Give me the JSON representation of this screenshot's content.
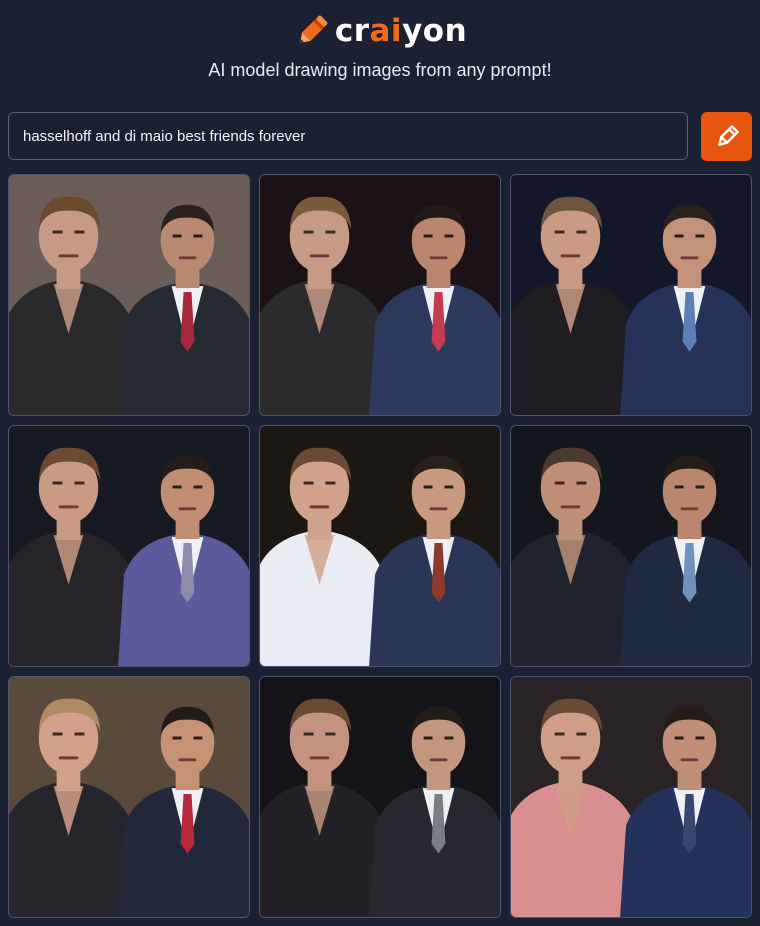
{
  "header": {
    "logo_prefix": "cr",
    "logo_accent": "ai",
    "logo_suffix": "yon",
    "logo_icon": "pencil-icon",
    "tagline": "AI model drawing images from any prompt!"
  },
  "prompt": {
    "value": "hasselhoff and di maio best friends forever",
    "draw_button_icon": "pencil-icon"
  },
  "colors": {
    "background": "#1a2133",
    "accent": "#e8550f",
    "tile_border": "#4d566c"
  },
  "results": {
    "images": [
      {
        "bg": "#6b5d58",
        "left_suit": "#2a2a2c",
        "left_skin": "#c79a85",
        "left_hair": "#6b4a2e",
        "right_suit": "#262a33",
        "right_skin": "#b98a72",
        "right_hair": "#2a201c",
        "tie": "#a7283a"
      },
      {
        "bg": "#1a1216",
        "left_suit": "#2b2a2d",
        "left_skin": "#c79a85",
        "left_hair": "#7a5a3c",
        "right_suit": "#2c3a5e",
        "right_skin": "#b9856c",
        "right_hair": "#231a16",
        "tie": "#c43a4e"
      },
      {
        "bg": "#14162a",
        "left_suit": "#1f1d22",
        "left_skin": "#c99b87",
        "left_hair": "#6f5540",
        "right_suit": "#26325a",
        "right_skin": "#c3927a",
        "right_hair": "#2a211c",
        "tie": "#5c7fb8"
      },
      {
        "bg": "#171a22",
        "left_suit": "#262428",
        "left_skin": "#c99a84",
        "left_hair": "#6b4a33",
        "right_suit": "#5b5a9a",
        "right_skin": "#c18e74",
        "right_hair": "#241c18",
        "tie": "#8c8cab"
      },
      {
        "bg": "#1d1714",
        "left_suit": "#e9ecf2",
        "left_skin": "#d0a28c",
        "left_hair": "#6a4a34",
        "right_suit": "#2b3558",
        "right_skin": "#c8987f",
        "right_hair": "#2a211d",
        "tie": "#8b3a2c"
      },
      {
        "bg": "#14161d",
        "left_suit": "#20232e",
        "left_skin": "#c08f7a",
        "left_hair": "#4d3a2e",
        "right_suit": "#1f2940",
        "right_skin": "#b9876e",
        "right_hair": "#251d18",
        "tie": "#6f92bc"
      },
      {
        "bg": "#5a4a3c",
        "left_suit": "#25262b",
        "left_skin": "#d2a18a",
        "left_hair": "#b08a62",
        "right_suit": "#23273a",
        "right_skin": "#c69274",
        "right_hair": "#231b16",
        "tie": "#b8283a"
      },
      {
        "bg": "#141318",
        "left_suit": "#222226",
        "left_skin": "#c49380",
        "left_hair": "#6b4a33",
        "right_suit": "#27282f",
        "right_skin": "#c3967f",
        "right_hair": "#231c18",
        "tie": "#7a7d86"
      },
      {
        "bg": "#2a2326",
        "left_suit": "#d98f8f",
        "left_skin": "#cf9d88",
        "left_hair": "#6a4a34",
        "right_suit": "#24315a",
        "right_skin": "#c08f76",
        "right_hair": "#261d18",
        "tie": "#364770"
      }
    ]
  }
}
